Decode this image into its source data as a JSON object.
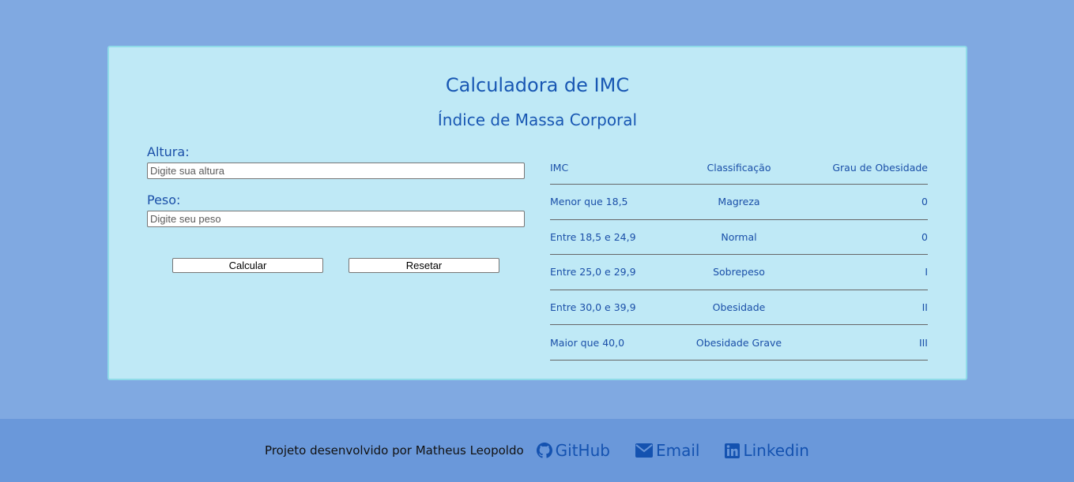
{
  "card": {
    "title": "Calculadora de IMC",
    "subtitle": "Índice de Massa Corporal"
  },
  "form": {
    "height_label": "Altura:",
    "height_placeholder": "Digite sua altura",
    "weight_label": "Peso:",
    "weight_placeholder": "Digite seu peso",
    "calculate_label": "Calcular",
    "reset_label": "Resetar"
  },
  "table": {
    "headers": [
      "IMC",
      "Classificação",
      "Grau de Obesidade"
    ],
    "rows": [
      [
        "Menor que 18,5",
        "Magreza",
        "0"
      ],
      [
        "Entre 18,5 e 24,9",
        "Normal",
        "0"
      ],
      [
        "Entre 25,0 e 29,9",
        "Sobrepeso",
        "I"
      ],
      [
        "Entre 30,0 e 39,9",
        "Obesidade",
        "II"
      ],
      [
        "Maior que 40,0",
        "Obesidade Grave",
        "III"
      ]
    ]
  },
  "footer": {
    "credit": "Projeto desenvolvido por Matheus Leopoldo",
    "links": [
      {
        "label": "GitHub",
        "icon": "github-icon"
      },
      {
        "label": "Email",
        "icon": "envelope-icon"
      },
      {
        "label": "Linkedin",
        "icon": "linkedin-icon"
      }
    ]
  },
  "colors": {
    "page_bg": "#80a9e1",
    "card_bg": "#bfe9f6",
    "footer_bg": "#6a98da",
    "accent": "#1857b3"
  }
}
